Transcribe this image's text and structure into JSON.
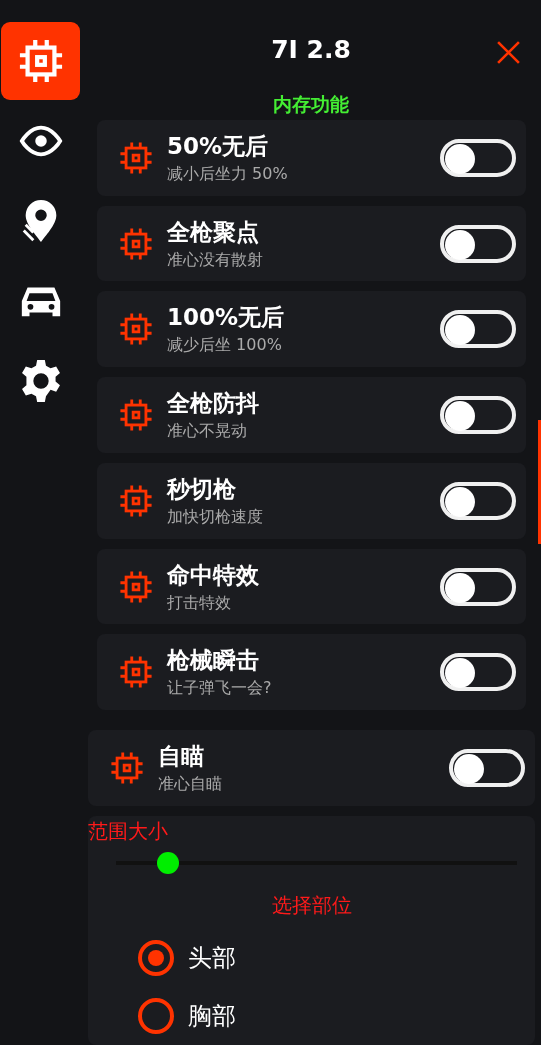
{
  "sidebar": {
    "items": [
      {
        "kind": "chip",
        "selected": true
      },
      {
        "kind": "eye",
        "selected": false
      },
      {
        "kind": "pin",
        "selected": false
      },
      {
        "kind": "car",
        "selected": false
      },
      {
        "kind": "gear",
        "selected": false
      }
    ]
  },
  "header": {
    "title": "7I 2.8"
  },
  "section_title": "内存功能",
  "features": [
    {
      "title": "50%无后",
      "subtitle": "减小后坐力 50%",
      "on": false
    },
    {
      "title": "全枪聚点",
      "subtitle": "准心没有散射",
      "on": false
    },
    {
      "title": "100%无后",
      "subtitle": "减少后坐 100%",
      "on": false
    },
    {
      "title": "全枪防抖",
      "subtitle": "准心不晃动",
      "on": false
    },
    {
      "title": "秒切枪",
      "subtitle": "加快切枪速度",
      "on": false
    },
    {
      "title": "命中特效",
      "subtitle": "打击特效",
      "on": false
    },
    {
      "title": "枪械瞬击",
      "subtitle": "让子弹飞一会?",
      "on": false
    }
  ],
  "aimbot": {
    "title": "自瞄",
    "subtitle": "准心自瞄",
    "on": false
  },
  "range": {
    "label": "范围大小",
    "level": 0.13
  },
  "target": {
    "label": "选择部位",
    "options": [
      {
        "label": "头部",
        "selected": true
      },
      {
        "label": "胸部",
        "selected": false
      }
    ]
  }
}
